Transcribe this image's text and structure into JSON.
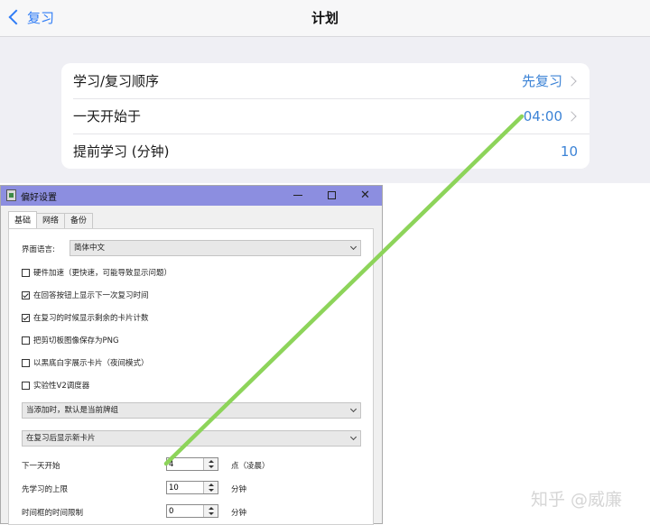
{
  "ipad": {
    "back_label": "复习",
    "title": "计划",
    "rows": [
      {
        "label": "学习/复习顺序",
        "value": "先复习"
      },
      {
        "label": "一天开始于",
        "value": "04:00"
      },
      {
        "label": "提前学习 (分钟)",
        "value": "10"
      }
    ]
  },
  "dialog": {
    "title": "偏好设置",
    "tabs": [
      "基础",
      "网络",
      "备份"
    ],
    "language_label": "界面语言:",
    "language_value": "简体中文",
    "checkboxes": [
      {
        "label": "硬件加速（更快速，可能导致显示问题）",
        "checked": false
      },
      {
        "label": "在回答按钮上显示下一次复习时间",
        "checked": true
      },
      {
        "label": "在复习的时候显示剩余的卡片计数",
        "checked": true
      },
      {
        "label": "把剪切板图像保存为PNG",
        "checked": false
      },
      {
        "label": "以黑底白字展示卡片（夜间模式）",
        "checked": false
      },
      {
        "label": "实验性V2调度器",
        "checked": false
      }
    ],
    "add_default_select": "当添加时，默认是当前牌组",
    "new_cards_select": "在复习后显示新卡片",
    "spinners": [
      {
        "label": "下一天开始",
        "value": "4",
        "unit": "点（凌晨）"
      },
      {
        "label": "先学习的上限",
        "value": "10",
        "unit": "分钟"
      },
      {
        "label": "时间框的时间限制",
        "value": "0",
        "unit": "分钟"
      }
    ]
  },
  "watermark": "知乎 @威廉",
  "colors": {
    "annotation": "#8dd45a",
    "ios_blue": "#3c83d6",
    "titlebar": "#8c8ee0"
  }
}
